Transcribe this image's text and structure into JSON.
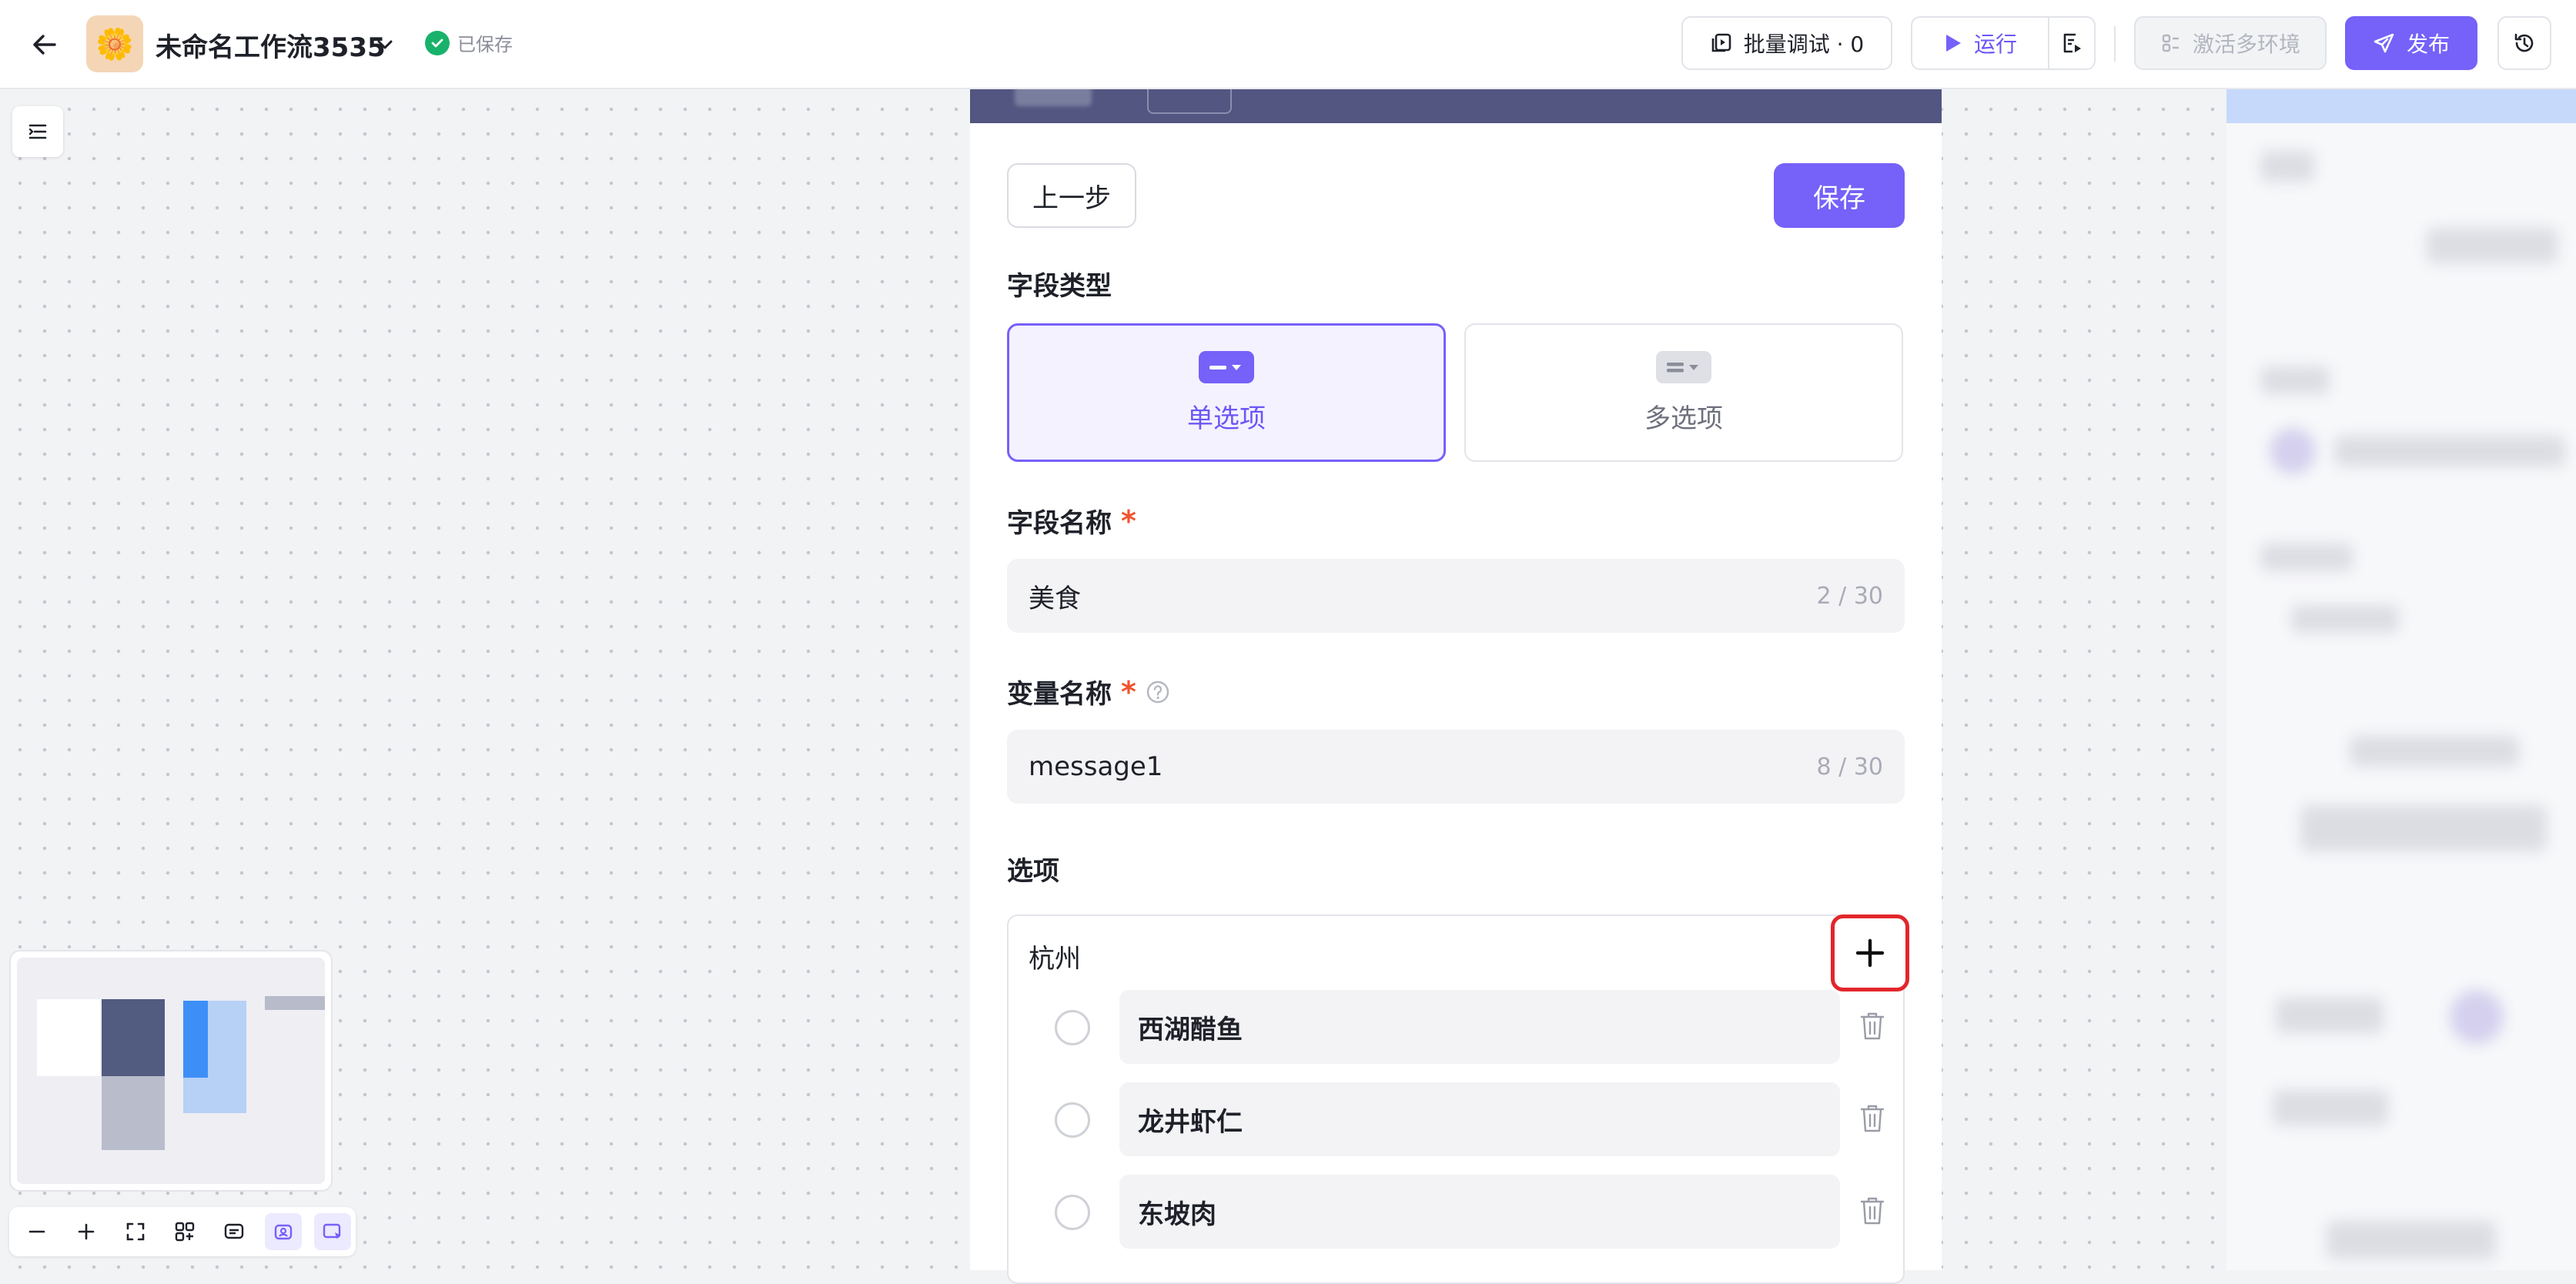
{
  "header": {
    "app_icon": "flower-emoji",
    "app_emoji": "🌼",
    "title": "未命名工作流3535",
    "saved_status": "已保存",
    "batch_debug_label": "批量调试 · 0",
    "run_label": "运行",
    "activate_env_label": "激活多环境",
    "publish_label": "发布"
  },
  "form": {
    "prev_label": "上一步",
    "save_label": "保存",
    "field_type_label": "字段类型",
    "type_single_label": "单选项",
    "type_multi_label": "多选项",
    "selected_type": "单选项",
    "field_name_label": "字段名称",
    "required_mark": "*",
    "field_name_value": "美食",
    "field_name_count": "2 / 30",
    "var_name_label": "变量名称",
    "var_name_value": "message1",
    "var_name_count": "8 / 30",
    "options_label": "选项",
    "option_group_title": "杭州",
    "options": [
      "西湖醋鱼",
      "龙井虾仁",
      "东坡肉"
    ]
  },
  "colors": {
    "accent": "#7661f9",
    "saved_green": "#18b26b",
    "required_red": "#f0532d",
    "highlight_border": "#e3262b"
  }
}
